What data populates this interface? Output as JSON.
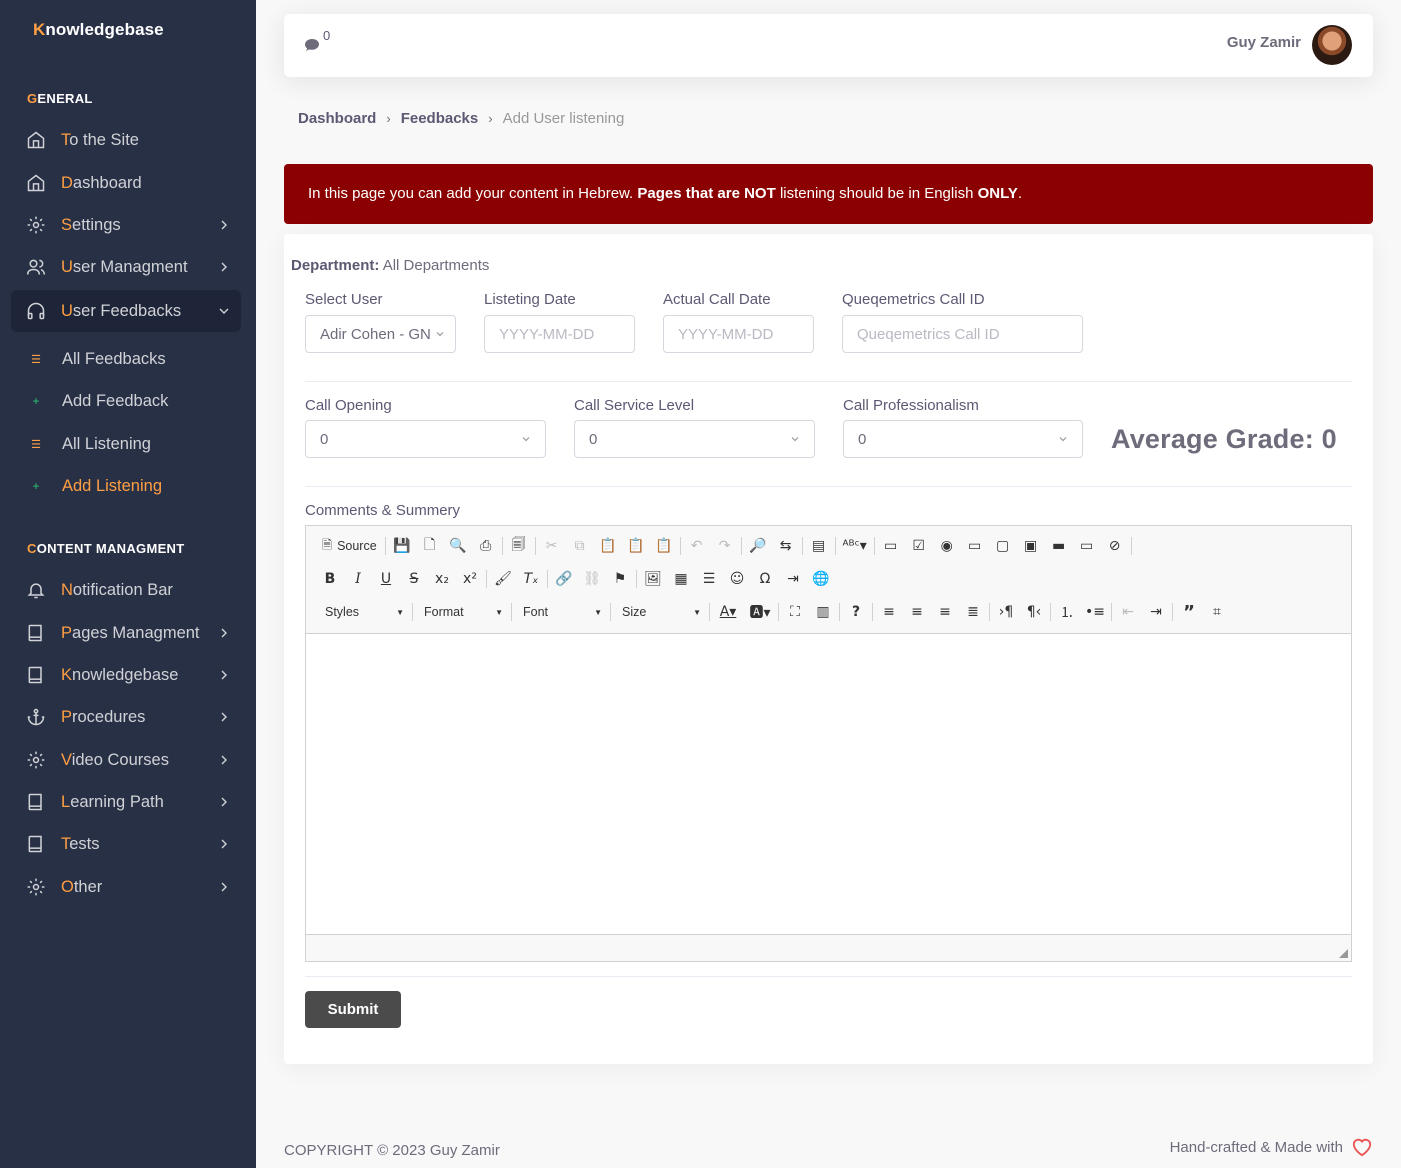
{
  "brand": {
    "first": "K",
    "rest": "nowledgebase"
  },
  "sidebar": {
    "general_title": {
      "first": "G",
      "rest": "ENERAL"
    },
    "general_items": [
      {
        "first": "T",
        "rest": "o the Site"
      },
      {
        "first": "D",
        "rest": "ashboard"
      },
      {
        "first": "S",
        "rest": "ettings"
      },
      {
        "first": "U",
        "rest": "ser Managment"
      },
      {
        "first": "U",
        "rest": "ser Feedbacks"
      }
    ],
    "sub_items": [
      "All Feedbacks",
      "Add Feedback",
      "All Listening",
      "Add Listening"
    ],
    "content_title": {
      "first": "C",
      "rest": "ONTENT MANAGMENT"
    },
    "content_items": [
      {
        "first": "N",
        "rest": "otification Bar"
      },
      {
        "first": "P",
        "rest": "ages Managment"
      },
      {
        "first": "K",
        "rest": "nowledgebase"
      },
      {
        "first": "P",
        "rest": "rocedures"
      },
      {
        "first": "V",
        "rest": "ideo Courses"
      },
      {
        "first": "L",
        "rest": "earning Path"
      },
      {
        "first": "T",
        "rest": "ests"
      },
      {
        "first": "O",
        "rest": "ther"
      }
    ]
  },
  "navbar": {
    "message_count": "0",
    "user_name": "Guy Zamir"
  },
  "breadcrumb": {
    "home": "Dashboard",
    "parent": "Feedbacks",
    "current": "Add User listening"
  },
  "alert": {
    "part1": "In this page you can add your content in Hebrew. ",
    "bold1": "Pages that are NOT",
    "part2": " listening should be in English ",
    "bold2": "ONLY",
    "part3": "."
  },
  "form": {
    "department_label": "Department:",
    "department_value": " All Departments",
    "select_user_label": "Select User",
    "select_user_value": "Adir Cohen - GN",
    "listening_date_label": "Listeting Date",
    "listening_date_placeholder": "YYYY-MM-DD",
    "actual_call_date_label": "Actual Call Date",
    "actual_call_date_placeholder": "YYYY-MM-DD",
    "call_id_label": "Queqemetrics Call ID",
    "call_id_placeholder": "Queqemetrics Call ID",
    "call_opening_label": "Call Opening",
    "call_opening_value": "0",
    "service_level_label": "Call Service Level",
    "service_level_value": "0",
    "professionalism_label": "Call Professionalism",
    "professionalism_value": "0",
    "average_grade": "Average Grade: 0",
    "comments_label": "Comments & Summery",
    "submit_label": "Submit"
  },
  "editor": {
    "source_label": "Source",
    "styles_label": "Styles",
    "format_label": "Format",
    "font_label": "Font",
    "size_label": "Size"
  },
  "footer": {
    "copyright": "COPYRIGHT © 2023 Guy Zamir",
    "made_with": "Hand-crafted & Made with"
  },
  "colors": {
    "sidebar_bg": "#283046",
    "accent": "#ff9f43",
    "alert_bg": "#8b0000",
    "submit_bg": "#4b4b4b"
  }
}
